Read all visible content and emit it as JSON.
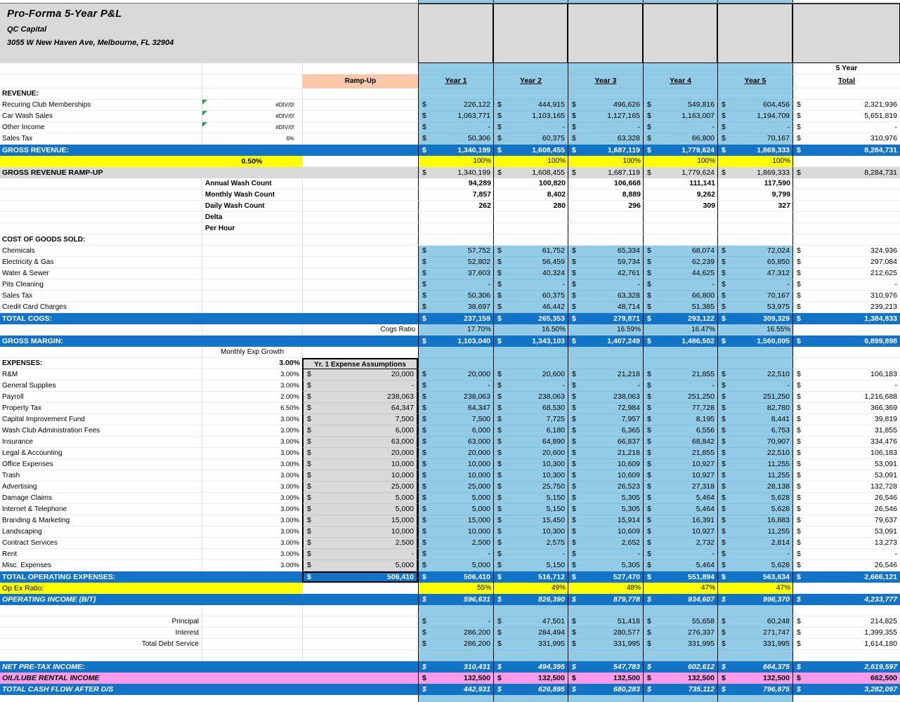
{
  "header": {
    "title": "Pro-Forma 5-Year P&L",
    "company": "QC Capital",
    "address": "3055 W New Haven Ave, Melbourne, FL 32904"
  },
  "colors": {
    "total_row_blue": "#1273C7",
    "data_light_blue": "#92CBE6",
    "highlight_yellow": "#FFFF00",
    "header_gray": "#D9D9D9",
    "ramp_up_peach": "#F9C9A9",
    "oil_lube_pink": "#F99BE8",
    "warning_triangle_green": "#2E9E4F"
  },
  "rows": [
    {
      "k": "colhead5",
      "yb": "lb",
      "t": "5 Year"
    },
    {
      "k": "colhead",
      "yb": "lb",
      "c3": "Ramp-Up",
      "v": [
        "Year 1",
        "Year 2",
        "Year 3",
        "Year 4",
        "Year 5"
      ],
      "t": "Total"
    },
    {
      "k": "sec",
      "l": "REVENUE:",
      "yb": "lb"
    },
    {
      "k": "item",
      "l": "Recuring Club Memberships",
      "c2": "#DIV/0!",
      "g": 1,
      "m": 1,
      "yb": "lb",
      "v": [
        "226,122",
        "444,915",
        "496,626",
        "549,816",
        "604,456"
      ],
      "t": "2,321,936"
    },
    {
      "k": "item",
      "l": "Car Wash Sales",
      "c2": "#DIV/0!",
      "g": 1,
      "m": 1,
      "yb": "lb",
      "v": [
        "1,063,771",
        "1,103,165",
        "1,127,165",
        "1,163,007",
        "1,194,709"
      ],
      "t": "5,651,819"
    },
    {
      "k": "item",
      "l": "Other Income",
      "c2": "#DIV/0!",
      "g": 1,
      "m": 1,
      "yb": "lb",
      "v": [
        "-",
        "-",
        "-",
        "-",
        "-"
      ],
      "t": "-"
    },
    {
      "k": "item",
      "l": "Sales Tax",
      "c2": "6%",
      "m": 1,
      "yb": "lb",
      "v": [
        "50,306",
        "60,375",
        "63,328",
        "66,800",
        "70,167"
      ],
      "t": "310,976"
    },
    {
      "k": "blue",
      "l": "GROSS REVENUE:",
      "m": 1,
      "v": [
        "1,340,199",
        "1,608,455",
        "1,687,119",
        "1,779,624",
        "1,869,333"
      ],
      "t": "8,284,731"
    },
    {
      "k": "yellow-a",
      "l": "",
      "c2": "0.50%",
      "yb": "yel",
      "v": [
        "100%",
        "100%",
        "100%",
        "100%",
        "100%"
      ],
      "t": ""
    },
    {
      "k": "gray",
      "l": "GROSS REVENUE RAMP-UP",
      "m": 1,
      "yb": "grb",
      "v": [
        "1,340,199",
        "1,608,455",
        "1,687,119",
        "1,779,624",
        "1,869,333"
      ],
      "t": "8,284,731"
    },
    {
      "k": "item-b2",
      "l": "Annual Wash Count",
      "yb": "wh",
      "v": [
        "94,289",
        "100,820",
        "106,668",
        "111,141",
        "117,590"
      ],
      "t": ""
    },
    {
      "k": "item-b2",
      "l": "Monthly Wash Count",
      "yb": "wh",
      "v": [
        "7,857",
        "8,402",
        "8,889",
        "9,262",
        "9,799"
      ],
      "t": ""
    },
    {
      "k": "item-b2",
      "l": "Daily Wash Count",
      "yb": "wh",
      "v": [
        "262",
        "280",
        "296",
        "309",
        "327"
      ],
      "t": ""
    },
    {
      "k": "item-b2",
      "l": "Delta",
      "yb": "wh",
      "v": [
        "",
        "",
        "",
        "",
        ""
      ],
      "t": ""
    },
    {
      "k": "item-b2",
      "l": "Per Hour",
      "yb": "wh",
      "v": [
        "",
        "",
        "",
        "",
        ""
      ],
      "t": ""
    },
    {
      "k": "sec",
      "l": "COST OF GOODS SOLD:",
      "yb": "wh"
    },
    {
      "k": "item",
      "l": "Chemicals",
      "m": 1,
      "yb": "lb",
      "v": [
        "57,752",
        "61,752",
        "65,334",
        "68,074",
        "72,024"
      ],
      "t": "324,936"
    },
    {
      "k": "item",
      "l": "Electricity & Gas",
      "m": 1,
      "yb": "lb",
      "v": [
        "52,802",
        "56,459",
        "59,734",
        "62,239",
        "65,850"
      ],
      "t": "297,084"
    },
    {
      "k": "item",
      "l": "Water & Sewer",
      "m": 1,
      "yb": "lb",
      "v": [
        "37,603",
        "40,324",
        "42,761",
        "44,625",
        "47,312"
      ],
      "t": "212,625"
    },
    {
      "k": "item",
      "l": "Pits Cleaning",
      "m": 1,
      "yb": "lb",
      "v": [
        "-",
        "-",
        "-",
        "-",
        "-"
      ],
      "t": "-"
    },
    {
      "k": "item",
      "l": "Sales Tax",
      "m": 1,
      "yb": "lb",
      "v": [
        "50,306",
        "60,375",
        "63,328",
        "66,800",
        "70,167"
      ],
      "t": "310,976"
    },
    {
      "k": "item",
      "l": "Credit Card Charges",
      "m": 1,
      "yb": "lb",
      "v": [
        "38,697",
        "46,442",
        "48,714",
        "51,385",
        "53,975"
      ],
      "t": "239,213"
    },
    {
      "k": "blue",
      "l": "TOTAL COGS:",
      "m": 1,
      "v": [
        "237,159",
        "265,353",
        "279,871",
        "293,122",
        "309,329"
      ],
      "t": "1,384,833"
    },
    {
      "k": "item-rc3",
      "l": "Cogs Ratio",
      "yb": "lb",
      "v": [
        "17.70%",
        "16.50%",
        "16.59%",
        "16.47%",
        "16.55%"
      ],
      "t": ""
    },
    {
      "k": "blue",
      "l": "GROSS MARGIN:",
      "m": 1,
      "v": [
        "1,103,040",
        "1,343,103",
        "1,407,249",
        "1,486,502",
        "1,560,005"
      ],
      "t": "6,899,898"
    },
    {
      "k": "item-c2c",
      "l": "",
      "c2": "Monthly Exp Growth",
      "yb": "lb"
    },
    {
      "k": "exp-head",
      "l": "EXPENSES:",
      "c2": "3.00%",
      "c3": "Yr. 1 Expense Assumptions",
      "yb": "lb"
    },
    {
      "k": "exp-item",
      "l": "R&M",
      "c2": "3.00%",
      "c3": "20,000",
      "m": 1,
      "yb": "lb",
      "v": [
        "20,000",
        "20,600",
        "21,218",
        "21,855",
        "22,510"
      ],
      "t": "106,183"
    },
    {
      "k": "exp-item",
      "l": "General Supplies",
      "c2": "3.00%",
      "c3": "-",
      "m": 1,
      "yb": "lb",
      "v": [
        "-",
        "-",
        "-",
        "-",
        "-"
      ],
      "t": "-"
    },
    {
      "k": "exp-item",
      "l": "Payroll",
      "c2": "2.00%",
      "c3": "238,063",
      "m": 1,
      "yb": "lb",
      "v": [
        "238,063",
        "238,063",
        "238,063",
        "251,250",
        "251,250"
      ],
      "t": "1,216,688"
    },
    {
      "k": "exp-item",
      "l": "Property Tax",
      "c2": "6.50%",
      "c3": "64,347",
      "m": 1,
      "yb": "lb",
      "v": [
        "64,347",
        "68,530",
        "72,984",
        "77,728",
        "82,780"
      ],
      "t": "366,369"
    },
    {
      "k": "exp-item",
      "l": "Capital Improvement Fund",
      "c2": "3.00%",
      "c3": "7,500",
      "m": 1,
      "yb": "lb",
      "v": [
        "7,500",
        "7,725",
        "7,957",
        "8,195",
        "8,441"
      ],
      "t": "39,819"
    },
    {
      "k": "exp-item",
      "l": "Wash Club Administration Fees",
      "c2": "3.00%",
      "c3": "6,000",
      "m": 1,
      "yb": "lb",
      "v": [
        "6,000",
        "6,180",
        "6,365",
        "6,556",
        "6,753"
      ],
      "t": "31,855"
    },
    {
      "k": "exp-item",
      "l": "Insurance",
      "c2": "3.00%",
      "c3": "63,000",
      "m": 1,
      "yb": "lb",
      "v": [
        "63,000",
        "64,890",
        "66,837",
        "68,842",
        "70,907"
      ],
      "t": "334,476"
    },
    {
      "k": "exp-item",
      "l": "Legal & Accounting",
      "c2": "3.00%",
      "c3": "20,000",
      "m": 1,
      "yb": "lb",
      "v": [
        "20,000",
        "20,600",
        "21,218",
        "21,855",
        "22,510"
      ],
      "t": "106,183"
    },
    {
      "k": "exp-item",
      "l": "Office Expenses",
      "c2": "3.00%",
      "c3": "10,000",
      "m": 1,
      "yb": "lb",
      "v": [
        "10,000",
        "10,300",
        "10,609",
        "10,927",
        "11,255"
      ],
      "t": "53,091"
    },
    {
      "k": "exp-item",
      "l": "Trash",
      "c2": "3.00%",
      "c3": "10,000",
      "m": 1,
      "yb": "lb",
      "v": [
        "10,000",
        "10,300",
        "10,609",
        "10,927",
        "11,255"
      ],
      "t": "53,091"
    },
    {
      "k": "exp-item",
      "l": "Advertising",
      "c2": "3.00%",
      "c3": "25,000",
      "m": 1,
      "yb": "lb",
      "v": [
        "25,000",
        "25,750",
        "26,523",
        "27,318",
        "28,138"
      ],
      "t": "132,728"
    },
    {
      "k": "exp-item",
      "l": "Damage Claims",
      "c2": "3.00%",
      "c3": "5,000",
      "m": 1,
      "yb": "lb",
      "v": [
        "5,000",
        "5,150",
        "5,305",
        "5,464",
        "5,628"
      ],
      "t": "26,546"
    },
    {
      "k": "exp-item",
      "l": "Internet & Telephone",
      "c2": "3.00%",
      "c3": "5,000",
      "m": 1,
      "yb": "lb",
      "v": [
        "5,000",
        "5,150",
        "5,305",
        "5,464",
        "5,628"
      ],
      "t": "26,546"
    },
    {
      "k": "exp-item",
      "l": "Branding & Marketing",
      "c2": "3.00%",
      "c3": "15,000",
      "m": 1,
      "yb": "lb",
      "v": [
        "15,000",
        "15,450",
        "15,914",
        "16,391",
        "16,883"
      ],
      "t": "79,637"
    },
    {
      "k": "exp-item",
      "l": "Landscaping",
      "c2": "3.00%",
      "c3": "10,000",
      "m": 1,
      "yb": "lb",
      "v": [
        "10,000",
        "10,300",
        "10,609",
        "10,927",
        "11,255"
      ],
      "t": "53,091"
    },
    {
      "k": "exp-item",
      "l": "Contract Services",
      "c2": "3.00%",
      "c3": "2,500",
      "m": 1,
      "yb": "lb",
      "v": [
        "2,500",
        "2,575",
        "2,652",
        "2,732",
        "2,814"
      ],
      "t": "13,273"
    },
    {
      "k": "exp-item",
      "l": "Rent",
      "c2": "3.00%",
      "c3": "-",
      "m": 1,
      "yb": "lb",
      "v": [
        "-",
        "-",
        "-",
        "-",
        "-"
      ],
      "t": "-"
    },
    {
      "k": "exp-item",
      "l": "Misc. Expenses",
      "c2": "3.00%",
      "c3": "5,000",
      "m": 1,
      "yb": "lb",
      "v": [
        "5,000",
        "5,150",
        "5,305",
        "5,464",
        "5,628"
      ],
      "t": "26,546"
    },
    {
      "k": "blue-exp",
      "l": "TOTAL OPERATING EXPENSES:",
      "c3": "506,410",
      "m": 1,
      "v": [
        "506,410",
        "516,712",
        "527,470",
        "551,894",
        "563,634"
      ],
      "t": "2,666,121"
    },
    {
      "k": "yellow-a",
      "l": "Op Ex Ratio:",
      "c2": "",
      "yb": "yel",
      "v": [
        "55%",
        "49%",
        "48%",
        "47%",
        "47%"
      ],
      "t": ""
    },
    {
      "k": "blue-i",
      "l": "OPERATING INCOME (B/T)",
      "m": 1,
      "v": [
        "596,631",
        "826,390",
        "879,778",
        "934,607",
        "996,370"
      ],
      "t": "4,233,777"
    },
    {
      "k": "spacer",
      "yb": "lb"
    },
    {
      "k": "item-r1",
      "l": "Principal",
      "m": 1,
      "yb": "lb",
      "v": [
        "-",
        "47,501",
        "51,418",
        "55,658",
        "60,248"
      ],
      "t": "214,825"
    },
    {
      "k": "item-r1",
      "l": "Interest",
      "m": 1,
      "yb": "lb",
      "v": [
        "286,200",
        "284,494",
        "280,577",
        "276,337",
        "271,747"
      ],
      "t": "1,399,355"
    },
    {
      "k": "item-r1",
      "l": "Total Debt Service",
      "m": 1,
      "yb": "lb",
      "v": [
        "286,200",
        "331,995",
        "331,995",
        "331,995",
        "331,995"
      ],
      "t": "1,614,180"
    },
    {
      "k": "spacer",
      "yb": "lb"
    },
    {
      "k": "blue-i",
      "l": "NET PRE-TAX INCOME:",
      "m": 1,
      "v": [
        "310,431",
        "494,395",
        "547,783",
        "602,612",
        "664,375"
      ],
      "t": "2,619,597"
    },
    {
      "k": "pink",
      "l": "OIL/LUBE RENTAL INCOME",
      "m": 1,
      "v": [
        "132,500",
        "132,500",
        "132,500",
        "132,500",
        "132,500"
      ],
      "t": "662,500"
    },
    {
      "k": "blue-i",
      "l": "TOTAL CASH FLOW AFTER D/S",
      "m": 1,
      "v": [
        "442,931",
        "626,895",
        "680,283",
        "735,112",
        "796,875"
      ],
      "t": "3,282,097"
    }
  ]
}
